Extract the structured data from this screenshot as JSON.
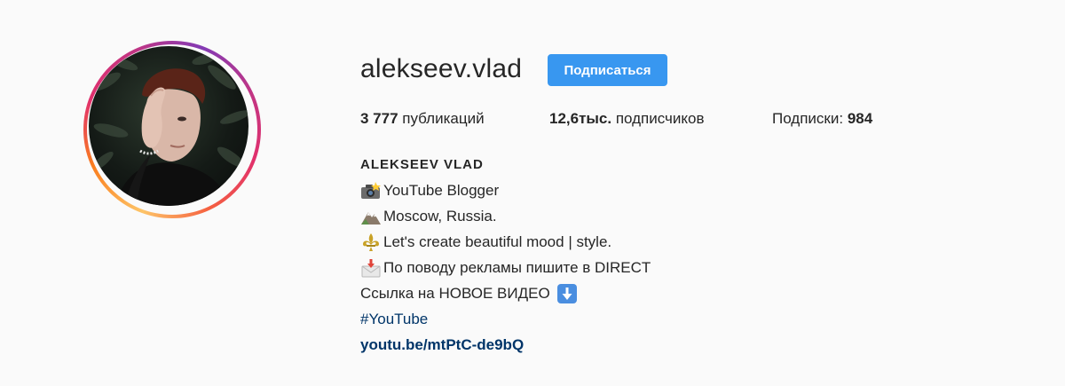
{
  "profile": {
    "username": "alekseev.vlad",
    "follow_label": "Подписаться",
    "avatar_icon": "profile-photo"
  },
  "stats": {
    "posts_count": "3 777",
    "posts_label": "публикаций",
    "followers_count": "12,6тыс.",
    "followers_label": "подписчиков",
    "following_label": "Подписки:",
    "following_count": "984"
  },
  "bio": {
    "name": "ALEKSEEV VLAD",
    "lines": [
      {
        "icon": "camera-flash-icon",
        "text": "YouTube Blogger"
      },
      {
        "icon": "mountain-icon",
        "text": "Moscow, Russia."
      },
      {
        "icon": "fleur-de-lis-icon",
        "text": "Let's create beautiful mood | style."
      },
      {
        "icon": "envelope-arrow-icon",
        "text": "По поводу рекламы пишите в DIRECT"
      },
      {
        "icon": "down-arrow-box-icon",
        "text": "Ссылка на НОВОЕ ВИДЕО"
      }
    ],
    "hashtag": "#YouTube",
    "url": "youtu.be/mtPtC-de9bQ"
  },
  "colors": {
    "follow_button": "#3897f0",
    "link": "#003569",
    "background": "#fafafa",
    "text": "#262626"
  }
}
